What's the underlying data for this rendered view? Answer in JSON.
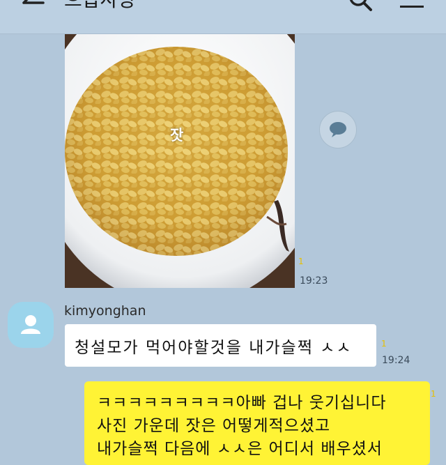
{
  "header": {
    "title": "으갑사앙",
    "back_icon": "arrow-left-icon",
    "search_icon": "search-icon",
    "menu_icon": "hamburger-menu-icon"
  },
  "messages": [
    {
      "type": "image",
      "caption": "잣",
      "unread": "1",
      "time": "19:23"
    },
    {
      "type": "text",
      "sender": "kimyonghan",
      "text": "청설모가 먹어야할것을 내가슬쩍 ㅅㅅ",
      "unread": "1",
      "time": "19:24"
    },
    {
      "type": "text",
      "mine": true,
      "lines": [
        "ㅋㅋㅋㅋㅋㅋㅋㅋㅋ아빠 겁나 웃기십니다",
        "사진 가운데 잣은 어떻게적으셨고",
        "내가슬쩍 다음에 ㅅㅅ은 어디서 배우셨서"
      ],
      "unread": "1"
    }
  ],
  "colors": {
    "background": "#b2c7da",
    "my_bubble": "#fff335",
    "other_bubble": "#ffffff",
    "unread": "#e6c000"
  }
}
